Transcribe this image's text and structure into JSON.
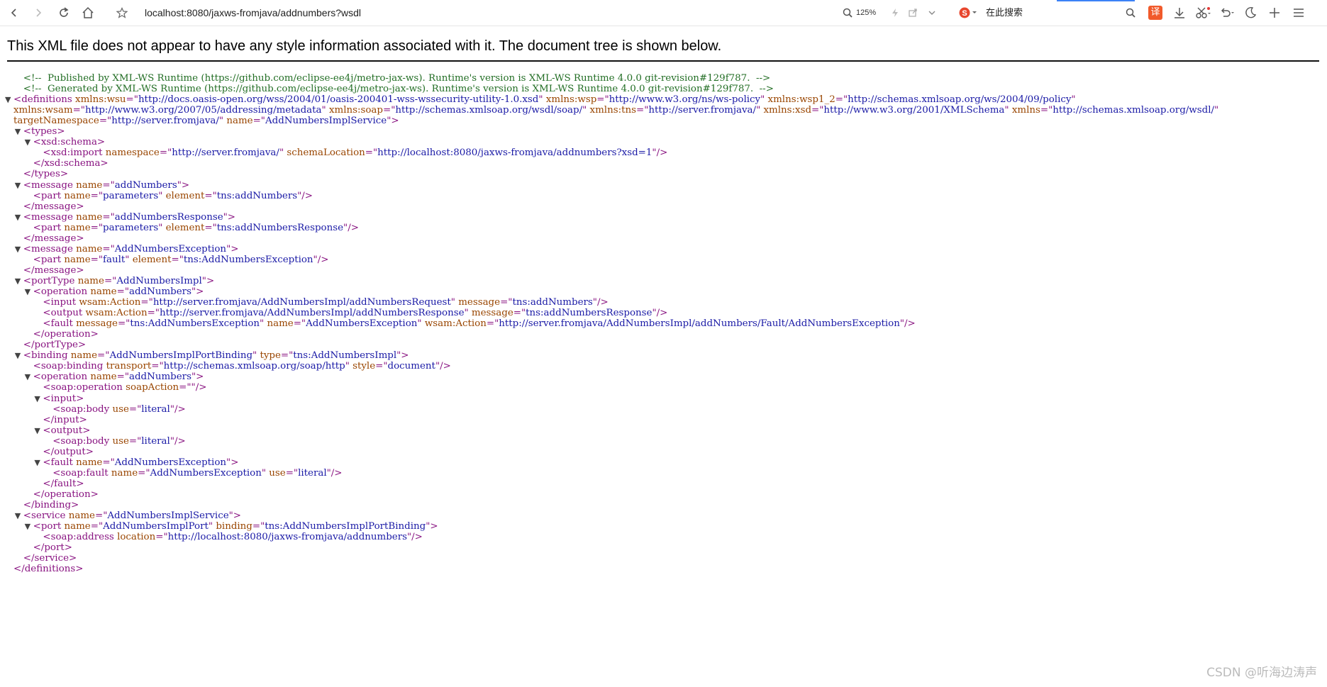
{
  "browser": {
    "url": "localhost:8080/jaxws-fromjava/addnumbers?wsdl",
    "zoom": "125%",
    "search_placeholder": "在此搜索",
    "translate_label": "译",
    "icons": [
      "back-icon",
      "forward-icon",
      "reload-icon",
      "home-icon",
      "star-icon",
      "zoom-icon",
      "lightning-icon",
      "share-icon",
      "chevron-down-icon",
      "sogou-search-icon",
      "search-icon",
      "translate-icon",
      "download-icon",
      "scissors-icon",
      "undo-icon",
      "moon-icon",
      "plus-icon",
      "menu-icon"
    ]
  },
  "notice": "This XML file does not appear to have any style information associated with it. The document tree is shown below.",
  "watermark": "CSDN @听海边涛声",
  "colors": {
    "tag": "#881280",
    "attr_name": "#994500",
    "attr_value": "#1a1aa6",
    "comment": "#236e25"
  },
  "xml_lines": [
    [
      {
        "t": "c",
        "v": "<!--  Published by XML-WS Runtime (https://github.com/eclipse-ee4j/metro-jax-ws). Runtime's version is XML-WS Runtime 4.0.0 git-revision#129f787.  -->"
      }
    ],
    [
      {
        "t": "c",
        "v": "<!--  Generated by XML-WS Runtime (https://github.com/eclipse-ee4j/metro-jax-ws). Runtime's version is XML-WS Runtime 4.0.0 git-revision#129f787.  -->"
      }
    ],
    [
      {
        "t": "t",
        "v": "<definitions"
      },
      {
        "t": "n",
        "v": " xmlns:wsu"
      },
      {
        "t": "t",
        "v": "=\""
      },
      {
        "t": "v",
        "v": "http://docs.oasis-open.org/wss/2004/01/oasis-200401-wss-wssecurity-utility-1.0.xsd"
      },
      {
        "t": "t",
        "v": "\""
      },
      {
        "t": "n",
        "v": " xmlns:wsp"
      },
      {
        "t": "t",
        "v": "=\""
      },
      {
        "t": "v",
        "v": "http://www.w3.org/ns/ws-policy"
      },
      {
        "t": "t",
        "v": "\""
      },
      {
        "t": "n",
        "v": " xmlns:wsp1_2"
      },
      {
        "t": "t",
        "v": "=\""
      },
      {
        "t": "v",
        "v": "http://schemas.xmlsoap.org/ws/2004/09/policy"
      },
      {
        "t": "t",
        "v": "\""
      }
    ],
    [
      {
        "t": "n",
        "v": "xmlns:wsam"
      },
      {
        "t": "t",
        "v": "=\""
      },
      {
        "t": "v",
        "v": "http://www.w3.org/2007/05/addressing/metadata"
      },
      {
        "t": "t",
        "v": "\""
      },
      {
        "t": "n",
        "v": " xmlns:soap"
      },
      {
        "t": "t",
        "v": "=\""
      },
      {
        "t": "v",
        "v": "http://schemas.xmlsoap.org/wsdl/soap/"
      },
      {
        "t": "t",
        "v": "\""
      },
      {
        "t": "n",
        "v": " xmlns:tns"
      },
      {
        "t": "t",
        "v": "=\""
      },
      {
        "t": "v",
        "v": "http://server.fromjava/"
      },
      {
        "t": "t",
        "v": "\""
      },
      {
        "t": "n",
        "v": " xmlns:xsd"
      },
      {
        "t": "t",
        "v": "=\""
      },
      {
        "t": "v",
        "v": "http://www.w3.org/2001/XMLSchema"
      },
      {
        "t": "t",
        "v": "\""
      },
      {
        "t": "n",
        "v": " xmlns"
      },
      {
        "t": "t",
        "v": "=\""
      },
      {
        "t": "v",
        "v": "http://schemas.xmlsoap.org/wsdl/"
      },
      {
        "t": "t",
        "v": "\""
      }
    ],
    [
      {
        "t": "n",
        "v": "targetNamespace"
      },
      {
        "t": "t",
        "v": "=\""
      },
      {
        "t": "v",
        "v": "http://server.fromjava/"
      },
      {
        "t": "t",
        "v": "\""
      },
      {
        "t": "n",
        "v": " name"
      },
      {
        "t": "t",
        "v": "=\""
      },
      {
        "t": "v",
        "v": "AddNumbersImplService"
      },
      {
        "t": "t",
        "v": "\">"
      }
    ],
    [
      {
        "t": "t",
        "v": "<types>"
      }
    ],
    [
      {
        "t": "t",
        "v": "<xsd:schema>"
      }
    ],
    [
      {
        "t": "t",
        "v": "<xsd:import"
      },
      {
        "t": "n",
        "v": " namespace"
      },
      {
        "t": "t",
        "v": "=\""
      },
      {
        "t": "v",
        "v": "http://server.fromjava/"
      },
      {
        "t": "t",
        "v": "\""
      },
      {
        "t": "n",
        "v": " schemaLocation"
      },
      {
        "t": "t",
        "v": "=\""
      },
      {
        "t": "v",
        "v": "http://localhost:8080/jaxws-fromjava/addnumbers?xsd=1"
      },
      {
        "t": "t",
        "v": "\"/>"
      }
    ],
    [
      {
        "t": "t",
        "v": "</xsd:schema>"
      }
    ],
    [
      {
        "t": "t",
        "v": "</types>"
      }
    ],
    [
      {
        "t": "t",
        "v": "<message"
      },
      {
        "t": "n",
        "v": " name"
      },
      {
        "t": "t",
        "v": "=\""
      },
      {
        "t": "v",
        "v": "addNumbers"
      },
      {
        "t": "t",
        "v": "\">"
      }
    ],
    [
      {
        "t": "t",
        "v": "<part"
      },
      {
        "t": "n",
        "v": " name"
      },
      {
        "t": "t",
        "v": "=\""
      },
      {
        "t": "v",
        "v": "parameters"
      },
      {
        "t": "t",
        "v": "\""
      },
      {
        "t": "n",
        "v": " element"
      },
      {
        "t": "t",
        "v": "=\""
      },
      {
        "t": "v",
        "v": "tns:addNumbers"
      },
      {
        "t": "t",
        "v": "\"/>"
      }
    ],
    [
      {
        "t": "t",
        "v": "</message>"
      }
    ],
    [
      {
        "t": "t",
        "v": "<message"
      },
      {
        "t": "n",
        "v": " name"
      },
      {
        "t": "t",
        "v": "=\""
      },
      {
        "t": "v",
        "v": "addNumbersResponse"
      },
      {
        "t": "t",
        "v": "\">"
      }
    ],
    [
      {
        "t": "t",
        "v": "<part"
      },
      {
        "t": "n",
        "v": " name"
      },
      {
        "t": "t",
        "v": "=\""
      },
      {
        "t": "v",
        "v": "parameters"
      },
      {
        "t": "t",
        "v": "\""
      },
      {
        "t": "n",
        "v": " element"
      },
      {
        "t": "t",
        "v": "=\""
      },
      {
        "t": "v",
        "v": "tns:addNumbersResponse"
      },
      {
        "t": "t",
        "v": "\"/>"
      }
    ],
    [
      {
        "t": "t",
        "v": "</message>"
      }
    ],
    [
      {
        "t": "t",
        "v": "<message"
      },
      {
        "t": "n",
        "v": " name"
      },
      {
        "t": "t",
        "v": "=\""
      },
      {
        "t": "v",
        "v": "AddNumbersException"
      },
      {
        "t": "t",
        "v": "\">"
      }
    ],
    [
      {
        "t": "t",
        "v": "<part"
      },
      {
        "t": "n",
        "v": " name"
      },
      {
        "t": "t",
        "v": "=\""
      },
      {
        "t": "v",
        "v": "fault"
      },
      {
        "t": "t",
        "v": "\""
      },
      {
        "t": "n",
        "v": " element"
      },
      {
        "t": "t",
        "v": "=\""
      },
      {
        "t": "v",
        "v": "tns:AddNumbersException"
      },
      {
        "t": "t",
        "v": "\"/>"
      }
    ],
    [
      {
        "t": "t",
        "v": "</message>"
      }
    ],
    [
      {
        "t": "t",
        "v": "<portType"
      },
      {
        "t": "n",
        "v": " name"
      },
      {
        "t": "t",
        "v": "=\""
      },
      {
        "t": "v",
        "v": "AddNumbersImpl"
      },
      {
        "t": "t",
        "v": "\">"
      }
    ],
    [
      {
        "t": "t",
        "v": "<operation"
      },
      {
        "t": "n",
        "v": " name"
      },
      {
        "t": "t",
        "v": "=\""
      },
      {
        "t": "v",
        "v": "addNumbers"
      },
      {
        "t": "t",
        "v": "\">"
      }
    ],
    [
      {
        "t": "t",
        "v": "<input"
      },
      {
        "t": "n",
        "v": " wsam:Action"
      },
      {
        "t": "t",
        "v": "=\""
      },
      {
        "t": "v",
        "v": "http://server.fromjava/AddNumbersImpl/addNumbersRequest"
      },
      {
        "t": "t",
        "v": "\""
      },
      {
        "t": "n",
        "v": " message"
      },
      {
        "t": "t",
        "v": "=\""
      },
      {
        "t": "v",
        "v": "tns:addNumbers"
      },
      {
        "t": "t",
        "v": "\"/>"
      }
    ],
    [
      {
        "t": "t",
        "v": "<output"
      },
      {
        "t": "n",
        "v": " wsam:Action"
      },
      {
        "t": "t",
        "v": "=\""
      },
      {
        "t": "v",
        "v": "http://server.fromjava/AddNumbersImpl/addNumbersResponse"
      },
      {
        "t": "t",
        "v": "\""
      },
      {
        "t": "n",
        "v": " message"
      },
      {
        "t": "t",
        "v": "=\""
      },
      {
        "t": "v",
        "v": "tns:addNumbersResponse"
      },
      {
        "t": "t",
        "v": "\"/>"
      }
    ],
    [
      {
        "t": "t",
        "v": "<fault"
      },
      {
        "t": "n",
        "v": " message"
      },
      {
        "t": "t",
        "v": "=\""
      },
      {
        "t": "v",
        "v": "tns:AddNumbersException"
      },
      {
        "t": "t",
        "v": "\""
      },
      {
        "t": "n",
        "v": " name"
      },
      {
        "t": "t",
        "v": "=\""
      },
      {
        "t": "v",
        "v": "AddNumbersException"
      },
      {
        "t": "t",
        "v": "\""
      },
      {
        "t": "n",
        "v": " wsam:Action"
      },
      {
        "t": "t",
        "v": "=\""
      },
      {
        "t": "v",
        "v": "http://server.fromjava/AddNumbersImpl/addNumbers/Fault/AddNumbersException"
      },
      {
        "t": "t",
        "v": "\"/>"
      }
    ],
    [
      {
        "t": "t",
        "v": "</operation>"
      }
    ],
    [
      {
        "t": "t",
        "v": "</portType>"
      }
    ],
    [
      {
        "t": "t",
        "v": "<binding"
      },
      {
        "t": "n",
        "v": " name"
      },
      {
        "t": "t",
        "v": "=\""
      },
      {
        "t": "v",
        "v": "AddNumbersImplPortBinding"
      },
      {
        "t": "t",
        "v": "\""
      },
      {
        "t": "n",
        "v": " type"
      },
      {
        "t": "t",
        "v": "=\""
      },
      {
        "t": "v",
        "v": "tns:AddNumbersImpl"
      },
      {
        "t": "t",
        "v": "\">"
      }
    ],
    [
      {
        "t": "t",
        "v": "<soap:binding"
      },
      {
        "t": "n",
        "v": " transport"
      },
      {
        "t": "t",
        "v": "=\""
      },
      {
        "t": "v",
        "v": "http://schemas.xmlsoap.org/soap/http"
      },
      {
        "t": "t",
        "v": "\""
      },
      {
        "t": "n",
        "v": " style"
      },
      {
        "t": "t",
        "v": "=\""
      },
      {
        "t": "v",
        "v": "document"
      },
      {
        "t": "t",
        "v": "\"/>"
      }
    ],
    [
      {
        "t": "t",
        "v": "<operation"
      },
      {
        "t": "n",
        "v": " name"
      },
      {
        "t": "t",
        "v": "=\""
      },
      {
        "t": "v",
        "v": "addNumbers"
      },
      {
        "t": "t",
        "v": "\">"
      }
    ],
    [
      {
        "t": "t",
        "v": "<soap:operation"
      },
      {
        "t": "n",
        "v": " soapAction"
      },
      {
        "t": "t",
        "v": "=\"\"/>"
      }
    ],
    [
      {
        "t": "t",
        "v": "<input>"
      }
    ],
    [
      {
        "t": "t",
        "v": "<soap:body"
      },
      {
        "t": "n",
        "v": " use"
      },
      {
        "t": "t",
        "v": "=\""
      },
      {
        "t": "v",
        "v": "literal"
      },
      {
        "t": "t",
        "v": "\"/>"
      }
    ],
    [
      {
        "t": "t",
        "v": "</input>"
      }
    ],
    [
      {
        "t": "t",
        "v": "<output>"
      }
    ],
    [
      {
        "t": "t",
        "v": "<soap:body"
      },
      {
        "t": "n",
        "v": " use"
      },
      {
        "t": "t",
        "v": "=\""
      },
      {
        "t": "v",
        "v": "literal"
      },
      {
        "t": "t",
        "v": "\"/>"
      }
    ],
    [
      {
        "t": "t",
        "v": "</output>"
      }
    ],
    [
      {
        "t": "t",
        "v": "<fault"
      },
      {
        "t": "n",
        "v": " name"
      },
      {
        "t": "t",
        "v": "=\""
      },
      {
        "t": "v",
        "v": "AddNumbersException"
      },
      {
        "t": "t",
        "v": "\">"
      }
    ],
    [
      {
        "t": "t",
        "v": "<soap:fault"
      },
      {
        "t": "n",
        "v": " name"
      },
      {
        "t": "t",
        "v": "=\""
      },
      {
        "t": "v",
        "v": "AddNumbersException"
      },
      {
        "t": "t",
        "v": "\""
      },
      {
        "t": "n",
        "v": " use"
      },
      {
        "t": "t",
        "v": "=\""
      },
      {
        "t": "v",
        "v": "literal"
      },
      {
        "t": "t",
        "v": "\"/>"
      }
    ],
    [
      {
        "t": "t",
        "v": "</fault>"
      }
    ],
    [
      {
        "t": "t",
        "v": "</operation>"
      }
    ],
    [
      {
        "t": "t",
        "v": "</binding>"
      }
    ],
    [
      {
        "t": "t",
        "v": "<service"
      },
      {
        "t": "n",
        "v": " name"
      },
      {
        "t": "t",
        "v": "=\""
      },
      {
        "t": "v",
        "v": "AddNumbersImplService"
      },
      {
        "t": "t",
        "v": "\">"
      }
    ],
    [
      {
        "t": "t",
        "v": "<port"
      },
      {
        "t": "n",
        "v": " name"
      },
      {
        "t": "t",
        "v": "=\""
      },
      {
        "t": "v",
        "v": "AddNumbersImplPort"
      },
      {
        "t": "t",
        "v": "\""
      },
      {
        "t": "n",
        "v": " binding"
      },
      {
        "t": "t",
        "v": "=\""
      },
      {
        "t": "v",
        "v": "tns:AddNumbersImplPortBinding"
      },
      {
        "t": "t",
        "v": "\">"
      }
    ],
    [
      {
        "t": "t",
        "v": "<soap:address"
      },
      {
        "t": "n",
        "v": " location"
      },
      {
        "t": "t",
        "v": "=\""
      },
      {
        "t": "v",
        "v": "http://localhost:8080/jaxws-fromjava/addnumbers"
      },
      {
        "t": "t",
        "v": "\"/>"
      }
    ],
    [
      {
        "t": "t",
        "v": "</port>"
      }
    ],
    [
      {
        "t": "t",
        "v": "</service>"
      }
    ],
    [
      {
        "t": "t",
        "v": "</definitions>"
      }
    ]
  ]
}
